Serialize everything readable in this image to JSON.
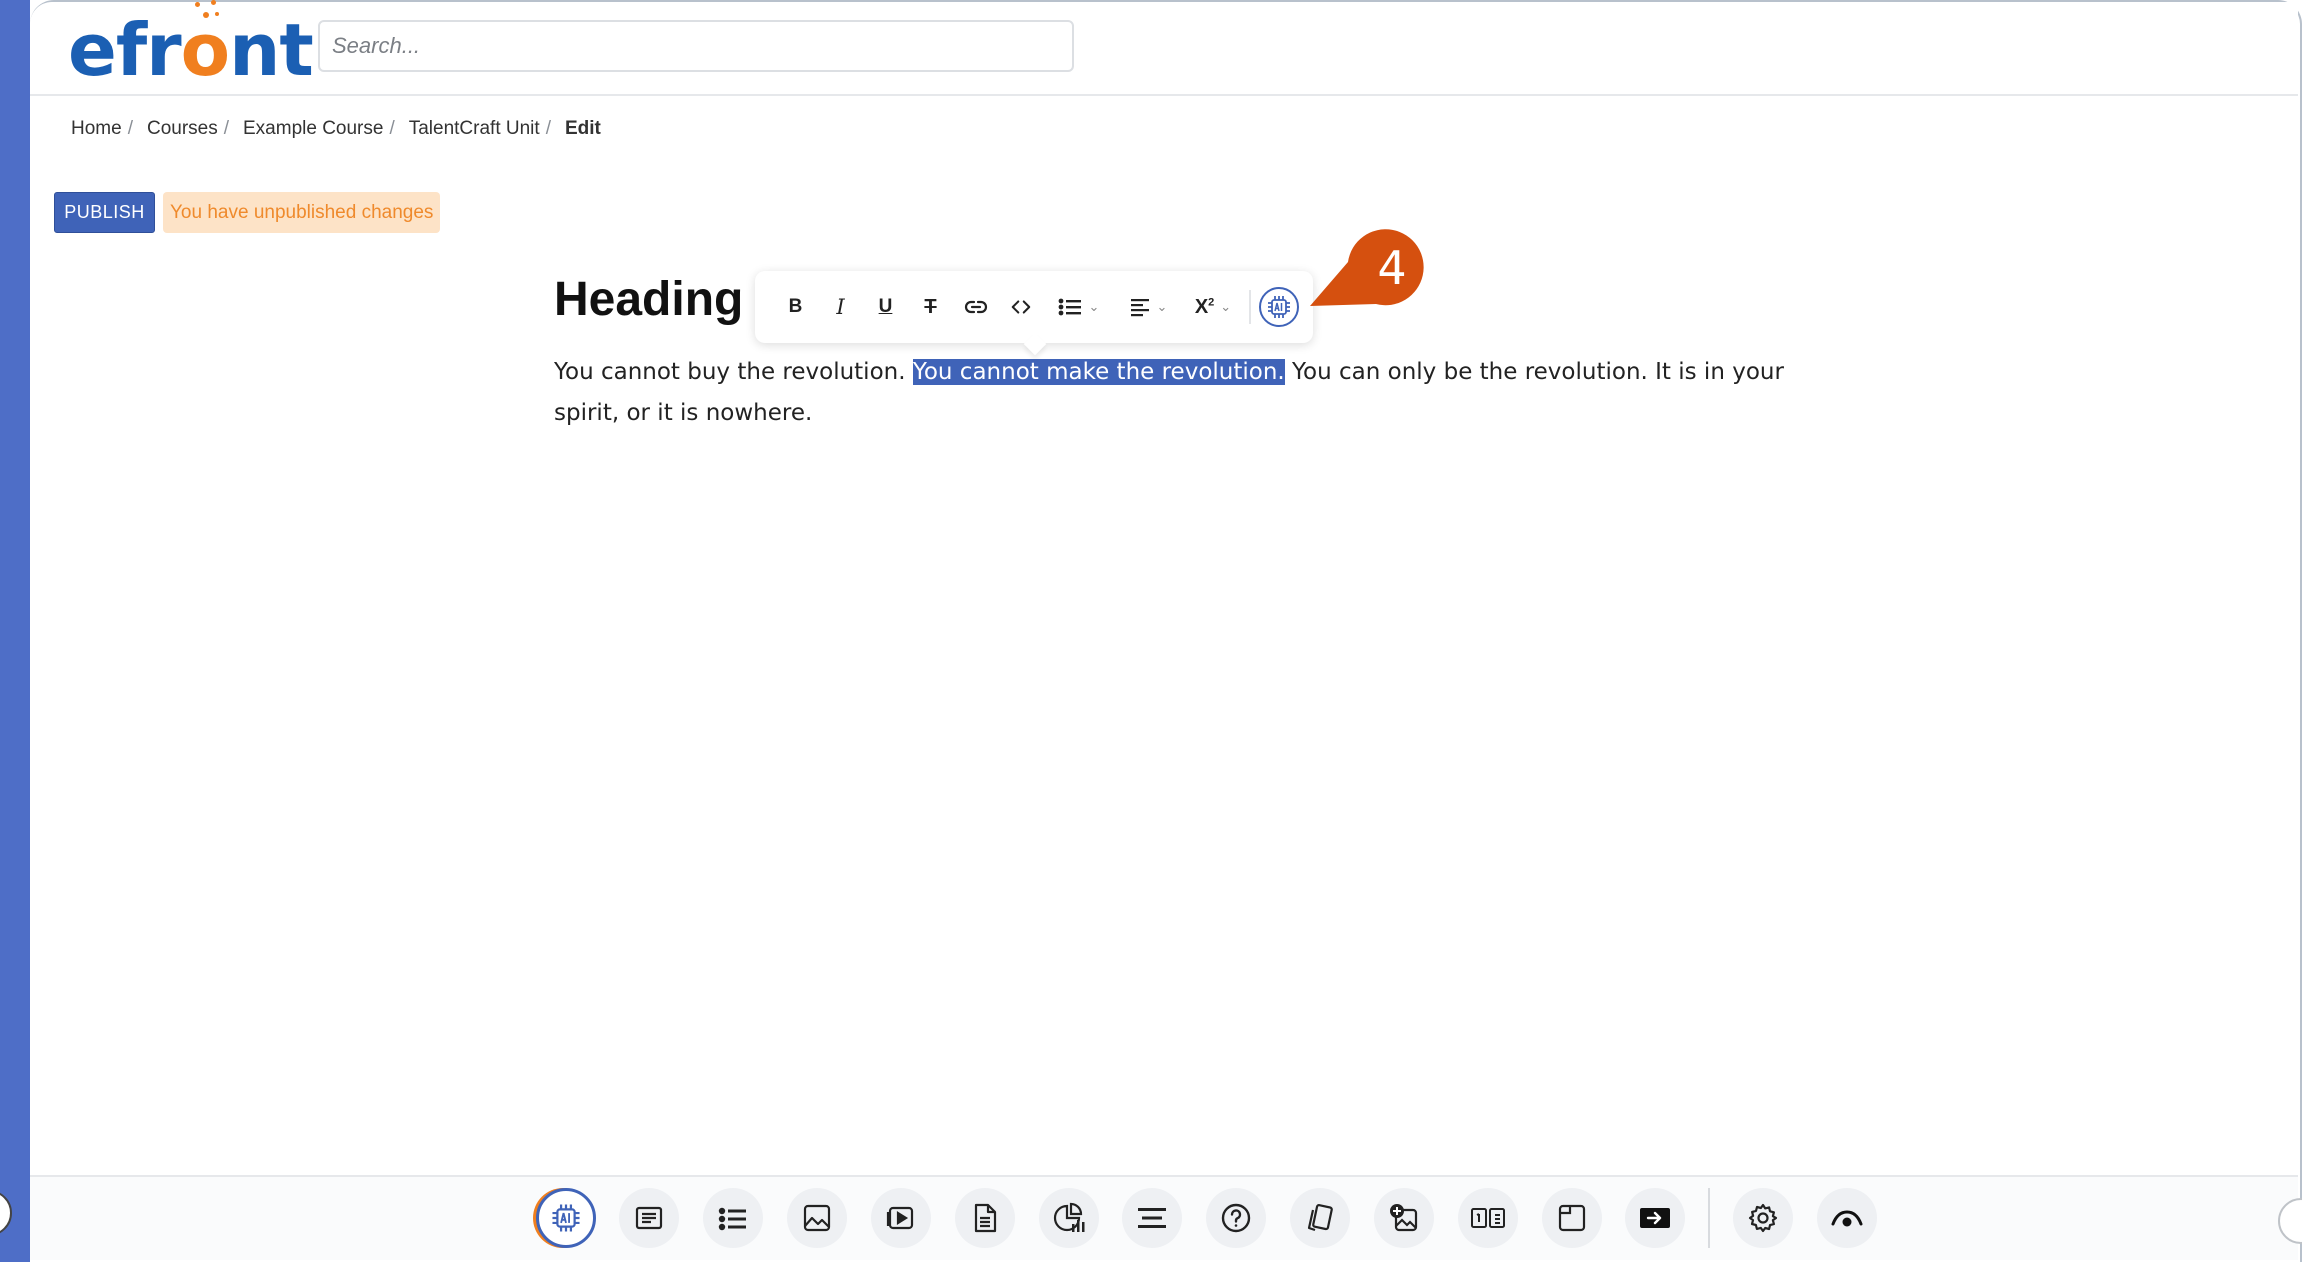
{
  "header": {
    "logo_prefix": "efr",
    "logo_o": "o",
    "logo_suffix": "nt",
    "search_placeholder": "Search..."
  },
  "breadcrumb": {
    "items": [
      "Home",
      "Courses",
      "Example Course",
      "TalentCraft Unit"
    ],
    "separator": "/",
    "current": "Edit"
  },
  "publish": {
    "button_label": "PUBLISH",
    "status_text": "You have unpublished changes"
  },
  "content": {
    "heading": "Heading",
    "text_before": "You cannot buy the revolution. ",
    "text_selected": "You cannot make the revolution.",
    "text_after": " You can only be the revolution. It is in your spirit, or it is nowhere."
  },
  "format_toolbar": {
    "bold": "B",
    "italic": "I",
    "underline": "U",
    "strike": "T",
    "superscript": "X",
    "superscript_mark": "2",
    "chevron": "⌄"
  },
  "callout": {
    "step_number": "4"
  },
  "colors": {
    "brand_blue": "#1b5fb3",
    "brand_orange": "#f07f1f",
    "accent": "#3f63b8",
    "selection": "#3f63b8",
    "warning_bg": "#fde3c7",
    "warning_text": "#ef8a2c",
    "callout": "#d5500f"
  },
  "bottom_toolbar": {
    "icons": [
      "ai-chip-icon",
      "text-block-icon",
      "list-icon",
      "image-icon",
      "video-icon",
      "document-icon",
      "chart-icon",
      "divider-lines-icon",
      "question-icon",
      "flashcards-icon",
      "image-add-icon",
      "compare-icon",
      "window-icon",
      "embed-icon",
      "gear-icon",
      "eye-icon"
    ]
  }
}
